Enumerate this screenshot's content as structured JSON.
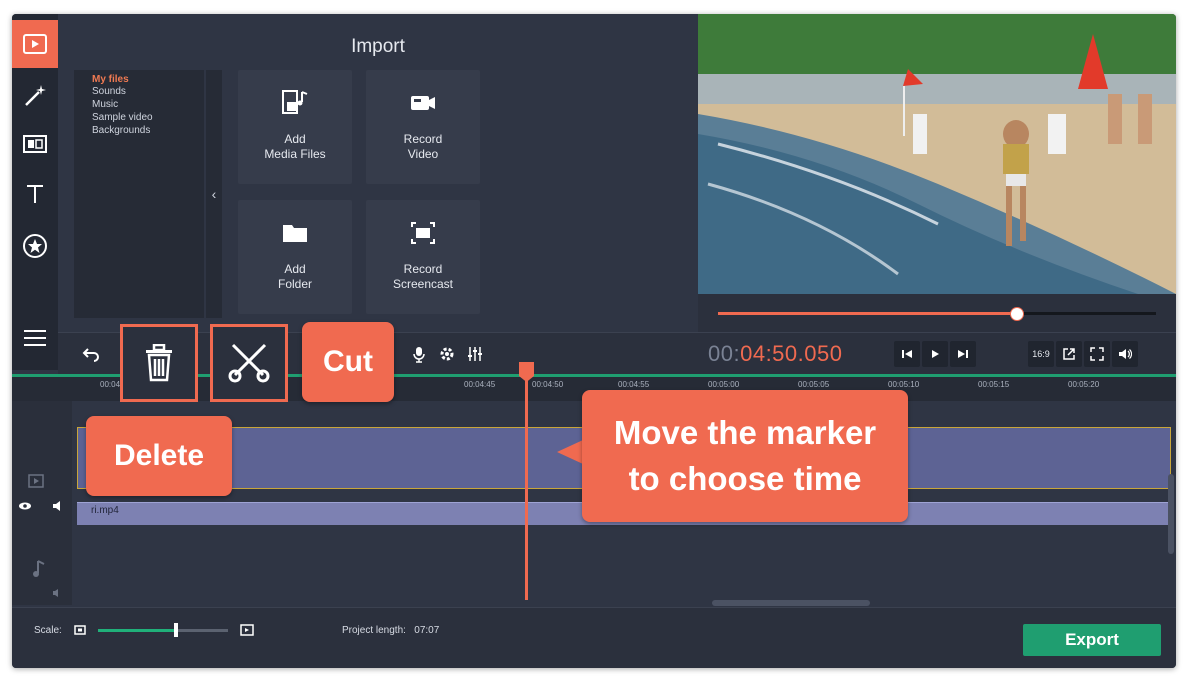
{
  "import": {
    "title": "Import",
    "file_categories": [
      "My files",
      "Sounds",
      "Music",
      "Sample video",
      "Backgrounds"
    ],
    "collapse_label": "‹",
    "tiles": {
      "add_media_line1": "Add",
      "add_media_line2": "Media Files",
      "record_video_line1": "Record",
      "record_video_line2": "Video",
      "add_folder_line1": "Add",
      "add_folder_line2": "Folder",
      "record_screencast_line1": "Record",
      "record_screencast_line2": "Screencast"
    }
  },
  "player": {
    "timecode_prefix": "00:",
    "timecode_main": "04:50.050",
    "progress": 0.68,
    "aspect_label": "16:9"
  },
  "timeline": {
    "ticks": [
      "00:04:25",
      "00:04:45",
      "00:04:50",
      "00:04:55",
      "00:05:00",
      "00:05:05",
      "00:05:10",
      "00:05:15",
      "00:05:20"
    ],
    "audio_clip_name": "ri.mp4"
  },
  "bottom": {
    "scale_label": "Scale:",
    "scale_level": 0.6,
    "project_length_label": "Project length:",
    "project_length_value": "07:07",
    "export_label": "Export"
  },
  "callouts": {
    "delete": "Delete",
    "cut": "Cut",
    "marker_line1": "Move the marker",
    "marker_line2": "to choose time"
  },
  "colors": {
    "accent": "#f06a50",
    "export_green": "#1f9e70",
    "panel": "#2f3544",
    "sidebar": "#232833"
  }
}
